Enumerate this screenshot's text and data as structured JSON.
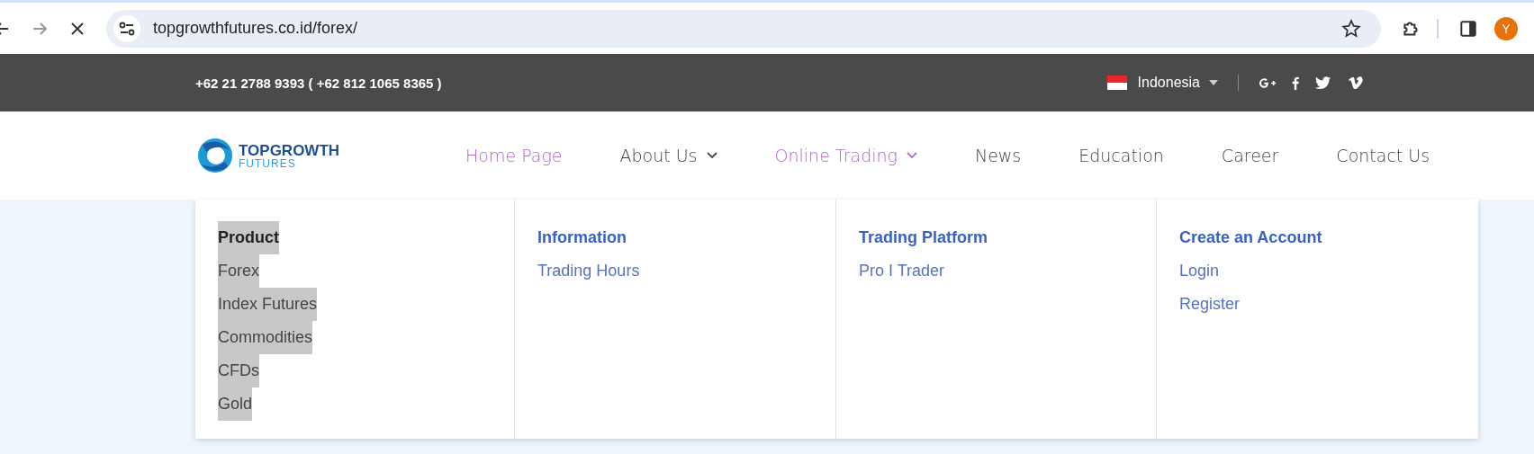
{
  "browser": {
    "url": "topgrowthfutures.co.id/forex/",
    "avatar": "Y"
  },
  "topbar": {
    "phone": "+62 21 2788 9393 ( +62 812 1065 8365 )",
    "language": "Indonesia"
  },
  "logo": {
    "name": "TOPGROWTH",
    "sub": "FUTURES"
  },
  "nav": [
    {
      "label": "Home Page",
      "selected": true,
      "dropdown": false
    },
    {
      "label": "About Us",
      "selected": false,
      "dropdown": true
    },
    {
      "label": "Online Trading",
      "selected": true,
      "dropdown": true
    },
    {
      "label": "News",
      "selected": false,
      "dropdown": false
    },
    {
      "label": "Education",
      "selected": false,
      "dropdown": false
    },
    {
      "label": "Career",
      "selected": false,
      "dropdown": false
    },
    {
      "label": "Contact Us",
      "selected": false,
      "dropdown": false
    }
  ],
  "mega_menu": [
    {
      "heading": "Product",
      "highlighted": true,
      "items": [
        "Forex",
        "Index Futures",
        "Commodities",
        "CFDs",
        "Gold"
      ]
    },
    {
      "heading": "Information",
      "highlighted": false,
      "items": [
        "Trading Hours"
      ]
    },
    {
      "heading": "Trading Platform",
      "highlighted": false,
      "items": [
        "Pro I Trader"
      ]
    },
    {
      "heading": "Create an Account",
      "highlighted": false,
      "items": [
        "Login",
        "Register"
      ]
    }
  ]
}
